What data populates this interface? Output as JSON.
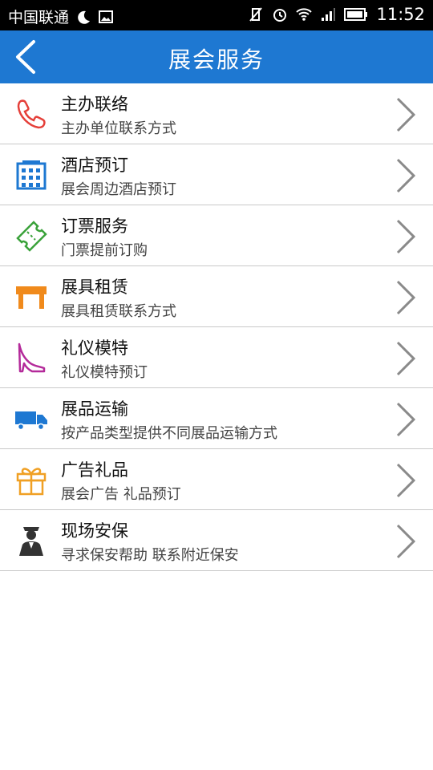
{
  "status_bar": {
    "carrier": "中国联通",
    "time": "11:52"
  },
  "header": {
    "title": "展会服务"
  },
  "services": [
    {
      "title": "主办联络",
      "subtitle": "主办单位联系方式",
      "icon": "phone-icon",
      "color": "#e5403a"
    },
    {
      "title": "酒店预订",
      "subtitle": "展会周边酒店预订",
      "icon": "hotel-building-icon",
      "color": "#1e78d2"
    },
    {
      "title": "订票服务",
      "subtitle": "门票提前订购",
      "icon": "ticket-icon",
      "color": "#3aa23a"
    },
    {
      "title": "展具租赁",
      "subtitle": "展具租赁联系方式",
      "icon": "table-icon",
      "color": "#f08a1c"
    },
    {
      "title": "礼仪模特",
      "subtitle": "礼仪模特预订",
      "icon": "high-heel-icon",
      "color": "#b42a9a"
    },
    {
      "title": "展品运输",
      "subtitle": "按产品类型提供不同展品运输方式",
      "icon": "truck-icon",
      "color": "#1e78d2"
    },
    {
      "title": "广告礼品",
      "subtitle": "展会广告 礼品预订",
      "icon": "gift-icon",
      "color": "#f0a024"
    },
    {
      "title": "现场安保",
      "subtitle": "寻求保安帮助 联系附近保安",
      "icon": "security-guard-icon",
      "color": "#333333"
    }
  ]
}
